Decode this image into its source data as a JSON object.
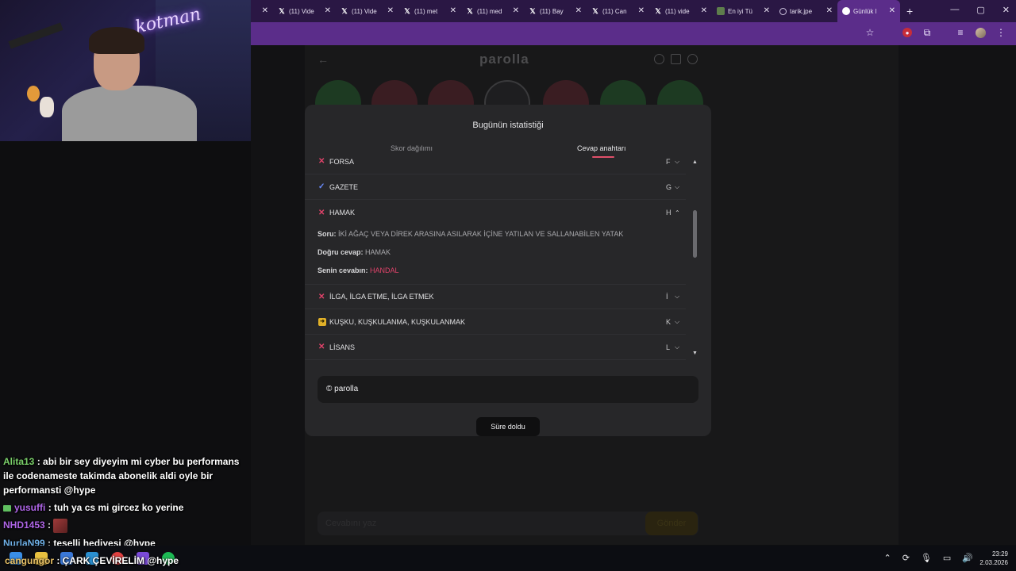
{
  "browser": {
    "tabs": [
      {
        "icon": "x-icon",
        "label": "(11) Vide"
      },
      {
        "icon": "x-icon",
        "label": "(11) Vide"
      },
      {
        "icon": "x-icon",
        "label": "(11) met"
      },
      {
        "icon": "x-icon",
        "label": "(11) med"
      },
      {
        "icon": "x-icon",
        "label": "(11) Bay"
      },
      {
        "icon": "x-icon",
        "label": "(11) Can"
      },
      {
        "icon": "x-icon",
        "label": "(11) vide"
      },
      {
        "icon": "doc-icon",
        "label": "En iyi Tü"
      },
      {
        "icon": "globe-icon",
        "label": "tarik.jpe"
      },
      {
        "icon": "active-icon",
        "label": "Günlük l"
      }
    ],
    "new_tab": "+",
    "window_controls": [
      "—",
      "▢",
      "✕"
    ]
  },
  "page": {
    "brand": "parolla",
    "back": "←",
    "bottom_input_placeholder": "Cevabını yaz",
    "bottom_button": "Gönder"
  },
  "modal": {
    "title": "Bugünün istatistiği",
    "tab_score": "Skor dağılımı",
    "tab_answers": "Cevap anahtarı",
    "rows": [
      {
        "status": "wrong",
        "word": "FORSA",
        "letter": "F",
        "chevron": "down"
      },
      {
        "status": "correct",
        "word": "GAZETE",
        "letter": "G",
        "chevron": "down"
      },
      {
        "status": "wrong",
        "word": "HAMAK",
        "letter": "H",
        "chevron": "up"
      },
      {
        "status": "wrong",
        "word": "İLGA, İLGA ETME, İLGA ETMEK",
        "letter": "İ",
        "chevron": "down"
      },
      {
        "status": "pass",
        "word": "KUŞKU, KUŞKULANMA, KUŞKULANMAK",
        "letter": "K",
        "chevron": "down"
      },
      {
        "status": "wrong",
        "word": "LİSANS",
        "letter": "L",
        "chevron": "down"
      }
    ],
    "detail": {
      "question_label": "Soru:",
      "question": "İKİ AĞAÇ VEYA DİREK ARASINA ASILARAK İÇİNE YATILAN VE SALLANABİLEN YATAK",
      "answer_label": "Doğru cevap:",
      "answer": "HAMAK",
      "yours_label": "Senin cevabın:",
      "yours": "HANDAL"
    },
    "copyright": "© parolla",
    "time_up": "Süre doldu"
  },
  "chat": [
    {
      "user": "Alita13",
      "text": ": abi bir sey diyeyim mi cyber bu performans ile codenameste takimda abonelik aldi oyle bir performansti @hype"
    },
    {
      "user": "yusuffi",
      "text": ": tuh ya cs mi gircez ko yerine"
    },
    {
      "user": "NHD1453",
      "text": ":"
    },
    {
      "user": "NurlaN99",
      "text": ": teselli hediyesi @hype"
    },
    {
      "user": "cangungor",
      "text": ": ÇARK ÇEVİRELİM @hype"
    }
  ],
  "webcam": {
    "neon_text": "kotman"
  },
  "taskbar": {
    "time": "23:29",
    "date": "2.03.2026"
  },
  "colors": {
    "accent": "#5b2d8a",
    "wrong": "#e0436a",
    "correct": "#6b8cff",
    "pass": "#e0b028"
  }
}
